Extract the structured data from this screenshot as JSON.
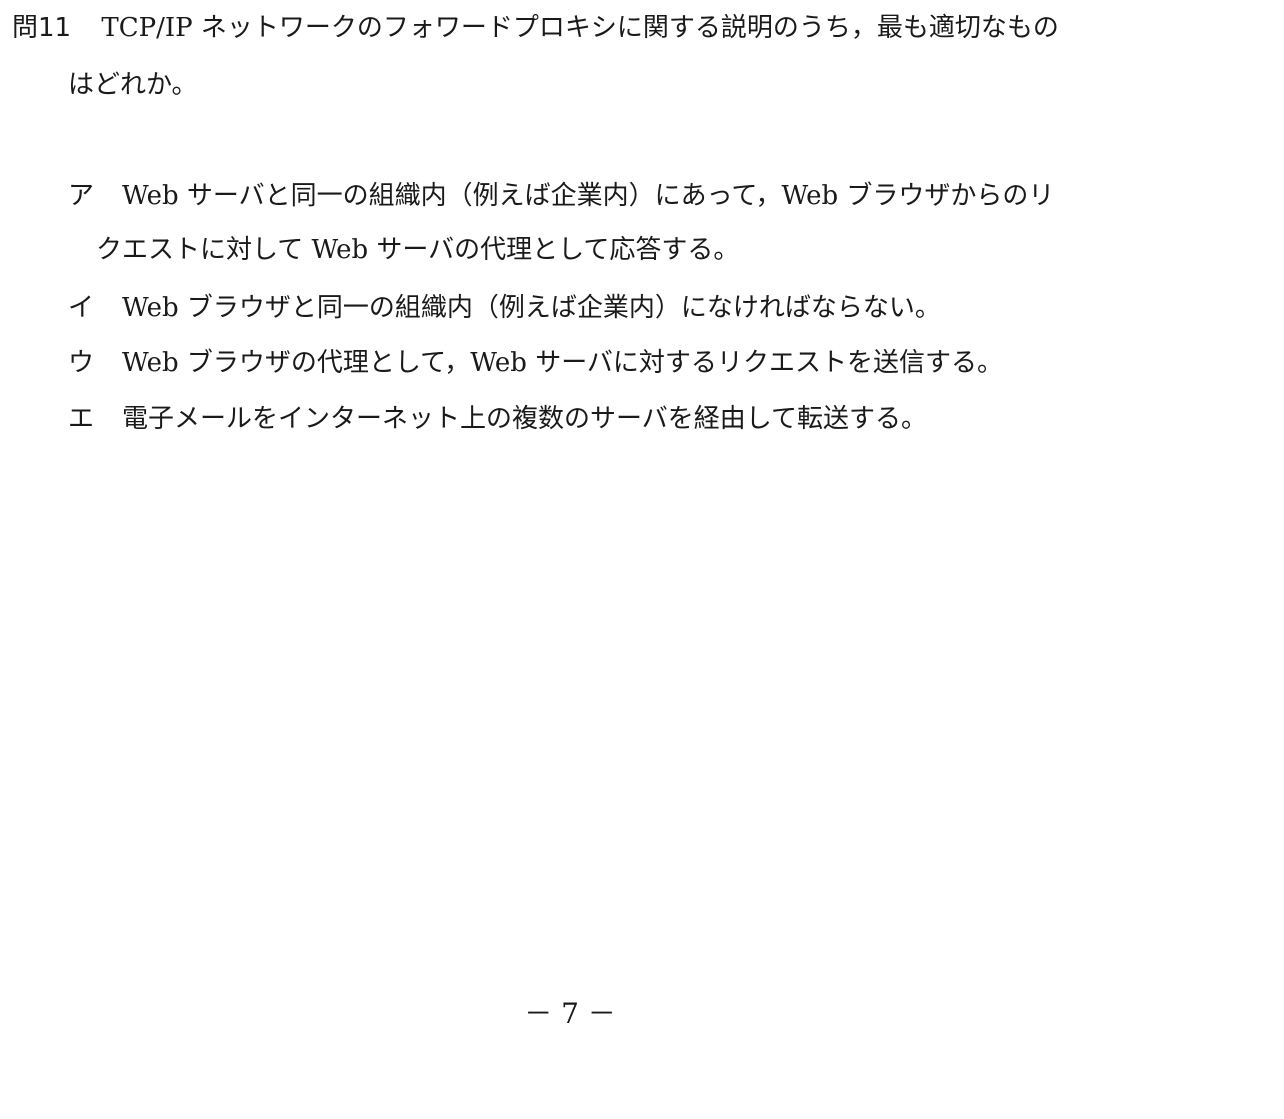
{
  "question": {
    "number": "問11",
    "text_line1": "TCP/IP ネットワークのフォワードプロキシに関する説明のうち，最も適切なもの",
    "text_line2": "はどれか。"
  },
  "options": [
    {
      "label": "ア",
      "line1": "Web サーバと同一の組織内（例えば企業内）にあって，Web ブラウザからのリ",
      "line2": "クエストに対して Web サーバの代理として応答する。"
    },
    {
      "label": "イ",
      "line1": "Web ブラウザと同一の組織内（例えば企業内）になければならない。"
    },
    {
      "label": "ウ",
      "line1": "Web ブラウザの代理として，Web サーバに対するリクエストを送信する。"
    },
    {
      "label": "エ",
      "line1": "電子メールをインターネット上の複数のサーバを経由して転送する。"
    }
  ],
  "page_number": "－ 7 －"
}
